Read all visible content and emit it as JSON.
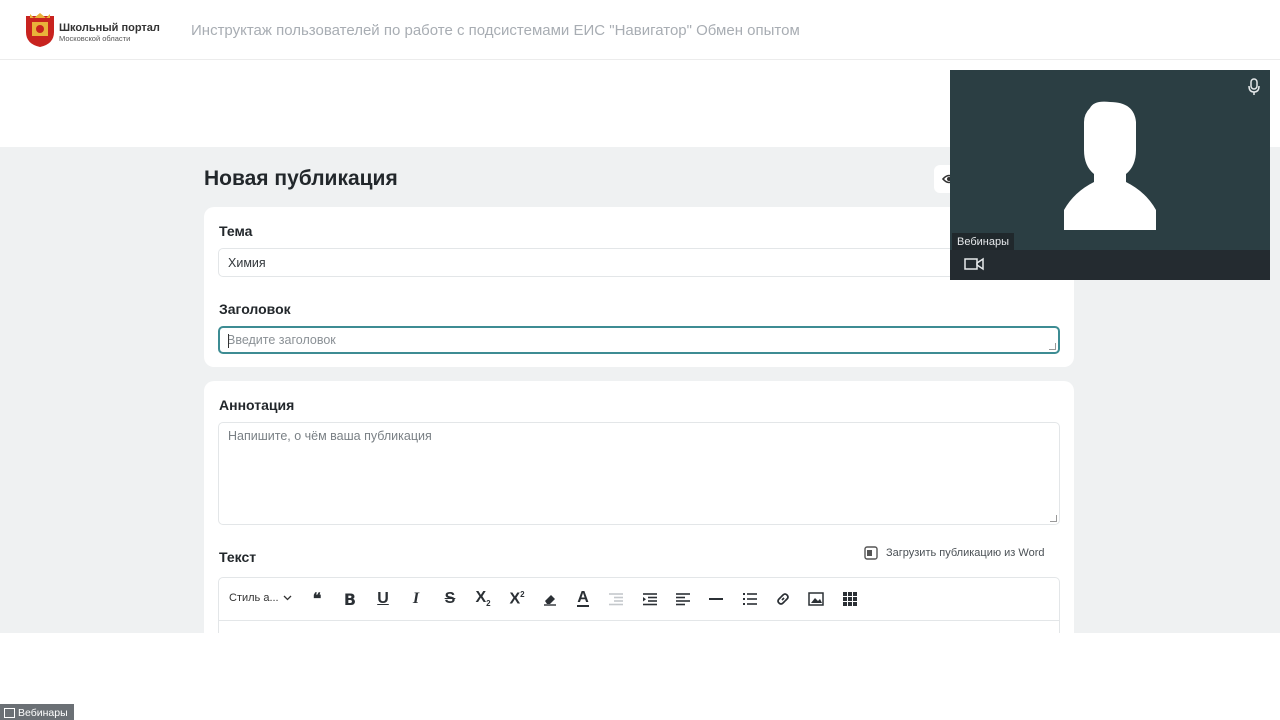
{
  "header": {
    "portal_name": "Школьный портал",
    "portal_region": "Московской области",
    "title": "Инструктаж пользователей по работе с подсистемами ЕИС \"Навигатор\" Обмен опытом"
  },
  "form": {
    "heading": "Новая публикация",
    "topic": {
      "label": "Тема",
      "value": "Химия"
    },
    "title_field": {
      "label": "Заголовок",
      "placeholder": "Введите заголовок",
      "value": ""
    },
    "annotation": {
      "label": "Аннотация",
      "placeholder": "Напишите, о чём ваша публикация"
    },
    "text": {
      "label": "Текст",
      "upload_word": "Загрузить публикацию из Word",
      "style_select": "Стиль а..."
    },
    "toolbar_icons": [
      "quote-icon",
      "bold-icon",
      "underline-icon",
      "italic-icon",
      "strikethrough-icon",
      "subscript-icon",
      "superscript-icon",
      "eraser-icon",
      "text-color-icon",
      "outdent-icon",
      "indent-icon",
      "align-left-icon",
      "horizontal-rule-icon",
      "numbered-list-icon",
      "link-icon",
      "image-icon",
      "table-icon"
    ]
  },
  "webcam": {
    "name": "Вебинары"
  },
  "bottom_tag": {
    "label": "Вебинары"
  },
  "colors": {
    "accent": "#3d8c93",
    "background": "#eff1f2",
    "webcam_bg": "#2b3e43"
  }
}
